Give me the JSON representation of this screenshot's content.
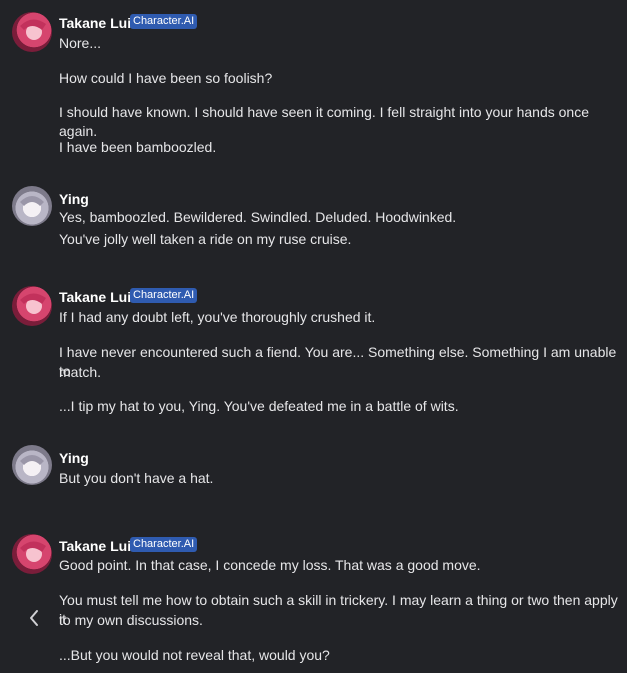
{
  "messages": [
    {
      "author": "Takane Lui",
      "badge": "Character.AI",
      "paragraphs": [
        "Nore...",
        "How could I have been so foolish?",
        "I should have known. I should have seen it coming. I fell straight into your hands once again.",
        "I have been bamboozled."
      ]
    },
    {
      "author": "Ying",
      "paragraphs": [
        "Yes, bamboozled. Bewildered. Swindled. Deluded. Hoodwinked.",
        "You've jolly well taken a ride on my ruse cruise."
      ]
    },
    {
      "author": "Takane Lui",
      "badge": "Character.AI",
      "paragraphs": [
        "If I had any doubt left, you've thoroughly crushed it.",
        "I have never encountered such a fiend. You are... Something else. Something I am unable to",
        "match.",
        "...I tip my hat to you, Ying. You've defeated me in a battle of wits."
      ]
    },
    {
      "author": "Ying",
      "paragraphs": [
        "But you don't have a hat."
      ]
    },
    {
      "author": "Takane Lui",
      "badge": "Character.AI",
      "paragraphs": [
        "Good point. In that case, I concede my loss. That was a good move.",
        "You must tell me how to obtain such a skill in trickery. I may learn a thing or two then apply it",
        "to my own discussions.",
        "...But you would not reveal that, would you?"
      ]
    }
  ],
  "icons": {
    "back": "chevron-left-icon",
    "takane_avatar": "avatar-takane",
    "ying_avatar": "avatar-ying"
  },
  "colors": {
    "background": "#222327",
    "badge": "#2f5bb0",
    "text": "#e6e6e8"
  }
}
